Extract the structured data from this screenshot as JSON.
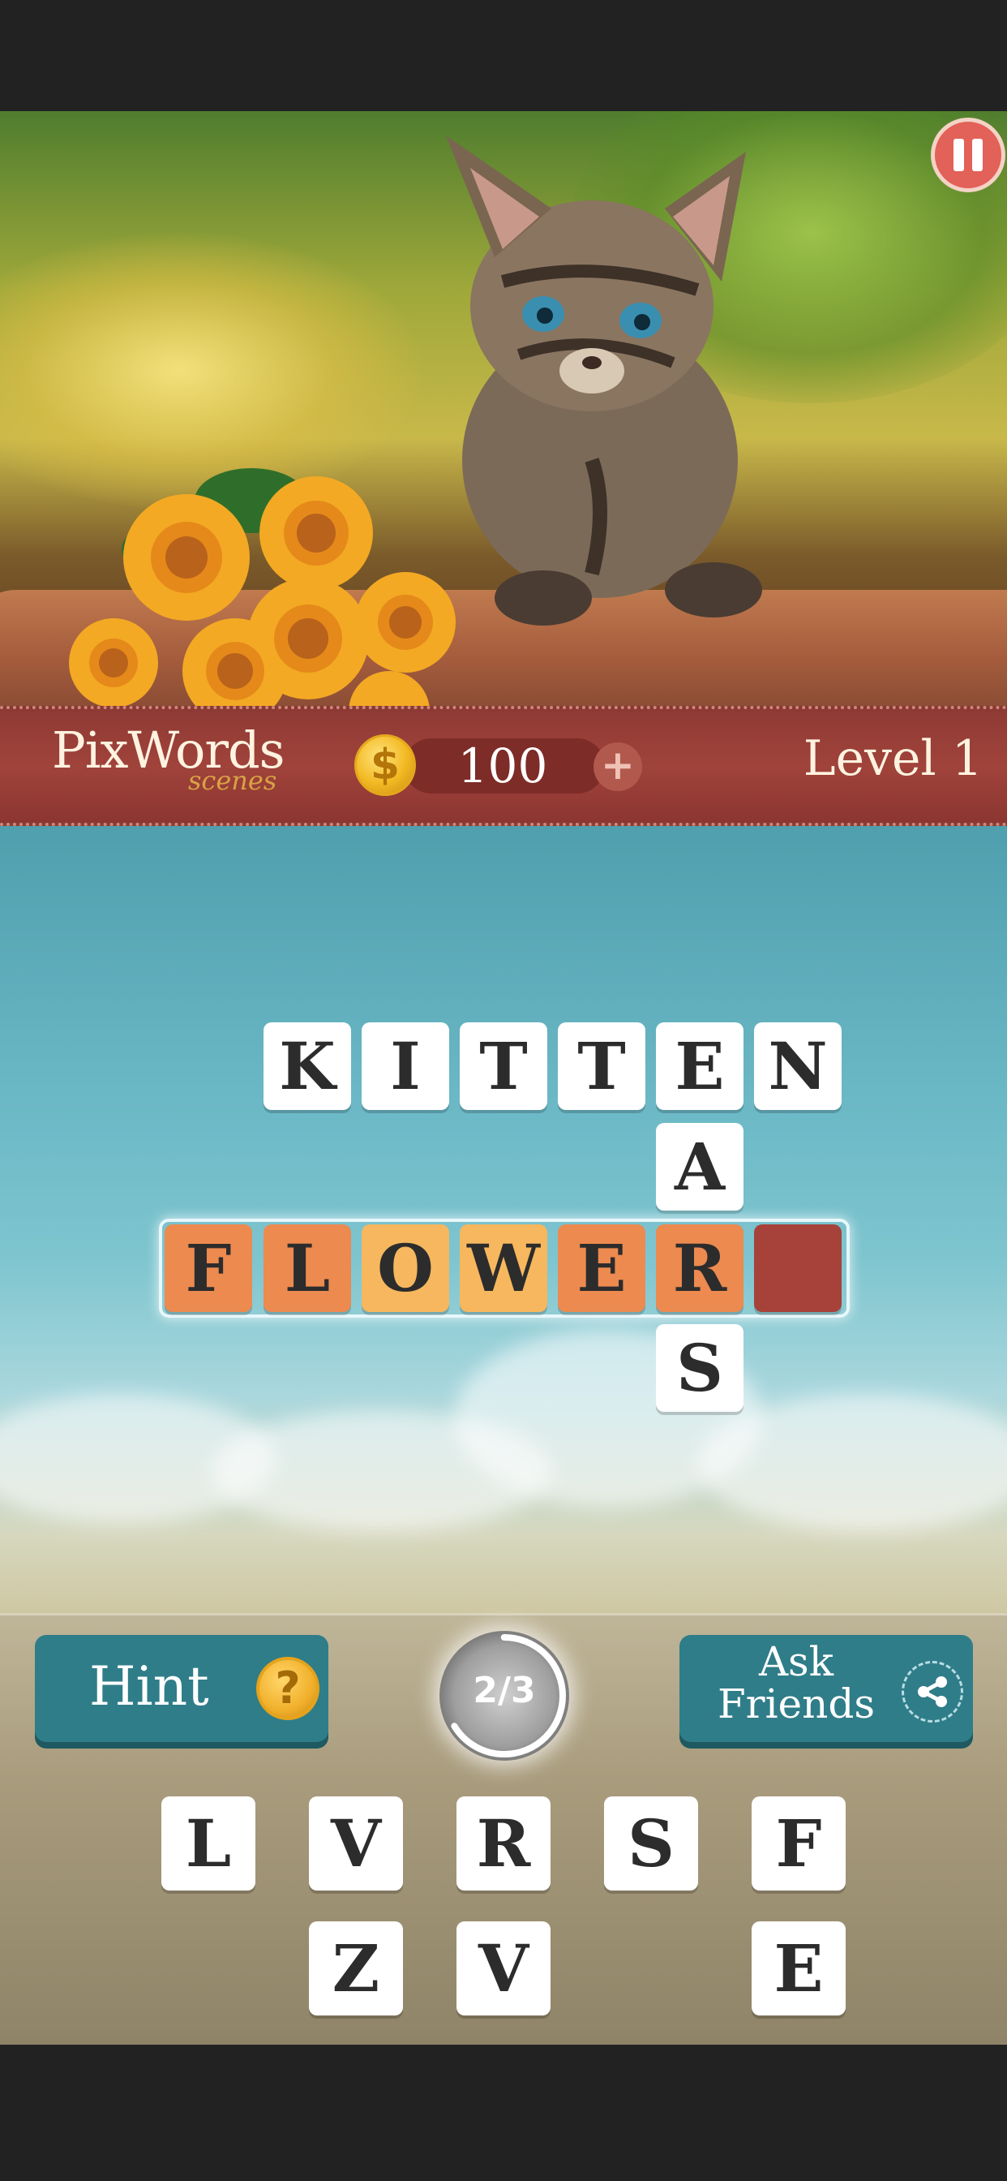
{
  "header": {
    "logo_main": "PixWords",
    "logo_sub": "scenes",
    "coins": "100",
    "coin_symbol": "$",
    "plus": "+",
    "level": "Level 1"
  },
  "puzzle": {
    "words": [
      {
        "word": "KITTEN",
        "direction": "across",
        "state": "solved"
      },
      {
        "word": "EARS",
        "direction": "down",
        "state": "solved"
      },
      {
        "word": "FLOWER",
        "direction": "across",
        "state": "active"
      }
    ],
    "row1": [
      "K",
      "I",
      "T",
      "T",
      "E",
      "N"
    ],
    "col_a": "A",
    "active_row": [
      "F",
      "L",
      "O",
      "W",
      "E",
      "R",
      ""
    ],
    "col_s": "S"
  },
  "controls": {
    "hint_label": "Hint",
    "hint_icon": "?",
    "progress": "2/3",
    "ask_line1": "Ask",
    "ask_line2": "Friends"
  },
  "letters": {
    "row1": [
      "L",
      "V",
      "R",
      "S",
      "F"
    ],
    "row2": [
      "Z",
      "V",
      "E"
    ]
  },
  "colors": {
    "header_red": "#a0433b",
    "button_teal": "#2f7d89",
    "tile_orange": "#ec8a4f",
    "tile_light_orange": "#f6b75e",
    "tile_empty_red": "#a6423a"
  },
  "icons": [
    "pause-icon",
    "coin-icon",
    "plus-icon",
    "question-icon",
    "share-icon"
  ]
}
